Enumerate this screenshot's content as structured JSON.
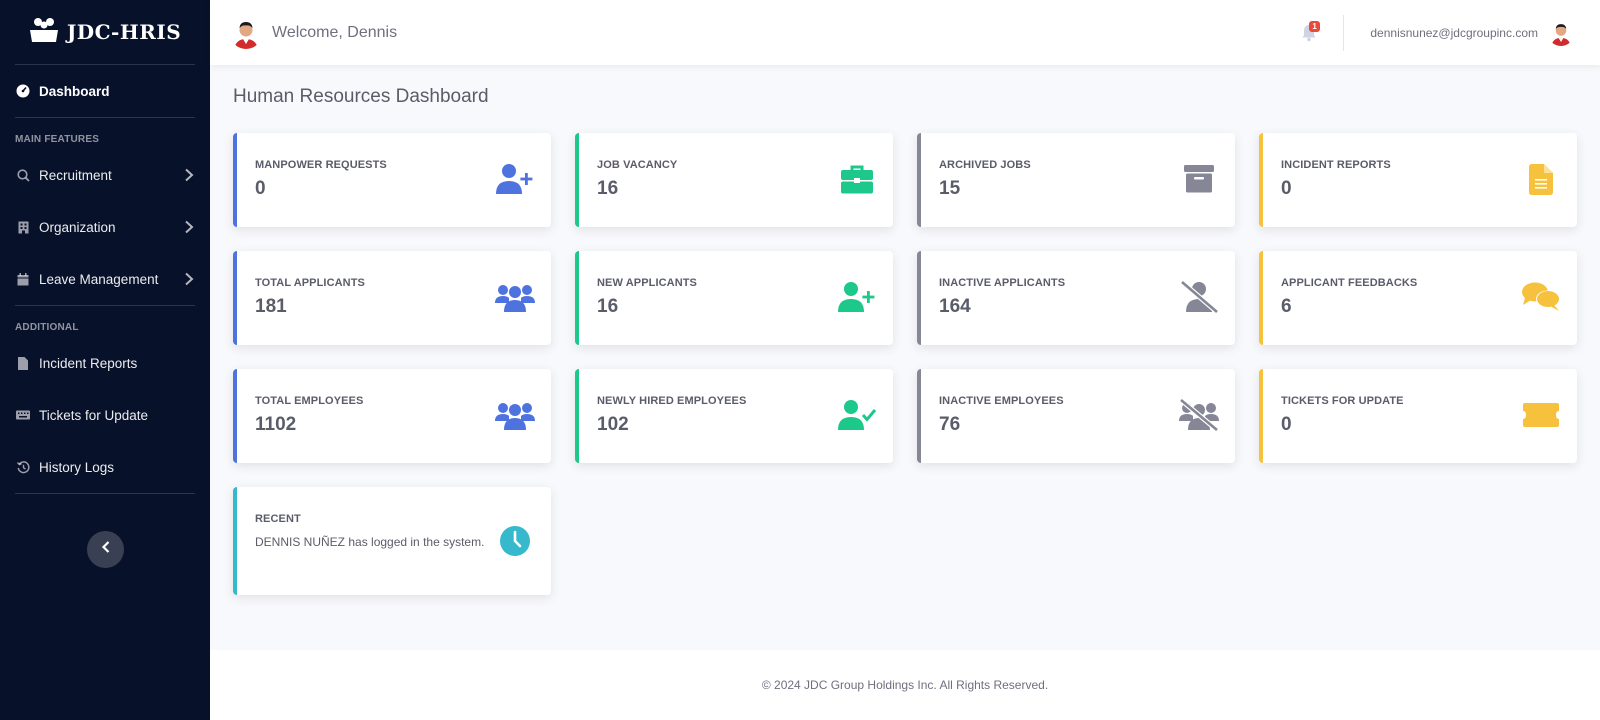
{
  "app": {
    "brand": "JDC-HRIS"
  },
  "sidebar": {
    "dashboard_label": "Dashboard",
    "section_main": "MAIN FEATURES",
    "section_additional": "ADDITIONAL",
    "items": [
      {
        "label": "Recruitment",
        "icon": "search-icon"
      },
      {
        "label": "Organization",
        "icon": "building-icon"
      },
      {
        "label": "Leave Management",
        "icon": "calendar-icon"
      },
      {
        "label": "Incident Reports",
        "icon": "file-icon"
      },
      {
        "label": "Tickets for Update",
        "icon": "keyboard-icon"
      },
      {
        "label": "History Logs",
        "icon": "history-icon"
      }
    ]
  },
  "topbar": {
    "welcome": "Welcome, Dennis",
    "notification_count": "1",
    "email": "dennisnunez@jdcgroupinc.com"
  },
  "main": {
    "title": "Human Resources Dashboard",
    "cards": [
      {
        "label": "MANPOWER REQUESTS",
        "value": "0",
        "icon": "user-plus-icon",
        "color": "#4e73df"
      },
      {
        "label": "JOB VACANCY",
        "value": "16",
        "icon": "briefcase-icon",
        "color": "#1cc88a"
      },
      {
        "label": "ARCHIVED JOBS",
        "value": "15",
        "icon": "archive-icon",
        "color": "#858796"
      },
      {
        "label": "INCIDENT REPORTS",
        "value": "0",
        "icon": "file-icon",
        "color": "#f6c23e"
      },
      {
        "label": "TOTAL APPLICANTS",
        "value": "181",
        "icon": "users-icon",
        "color": "#4e73df"
      },
      {
        "label": "NEW APPLICANTS",
        "value": "16",
        "icon": "user-plus-icon",
        "color": "#1cc88a"
      },
      {
        "label": "INACTIVE APPLICANTS",
        "value": "164",
        "icon": "user-slash-icon",
        "color": "#858796"
      },
      {
        "label": "APPLICANT FEEDBACKS",
        "value": "6",
        "icon": "comments-icon",
        "color": "#f6c23e"
      },
      {
        "label": "TOTAL EMPLOYEES",
        "value": "1102",
        "icon": "users-icon",
        "color": "#4e73df"
      },
      {
        "label": "NEWLY HIRED EMPLOYEES",
        "value": "102",
        "icon": "user-check-icon",
        "color": "#1cc88a"
      },
      {
        "label": "INACTIVE EMPLOYEES",
        "value": "76",
        "icon": "users-slash-icon",
        "color": "#858796"
      },
      {
        "label": "TICKETS FOR UPDATE",
        "value": "0",
        "icon": "ticket-icon",
        "color": "#f6c23e"
      }
    ],
    "recent": {
      "label": "RECENT",
      "text": "DENNIS NUÑEZ has logged in the system.",
      "icon": "clock-icon",
      "color": "#36b9cc"
    }
  },
  "footer": {
    "text": "© 2024 JDC Group Holdings Inc. All Rights Reserved."
  }
}
